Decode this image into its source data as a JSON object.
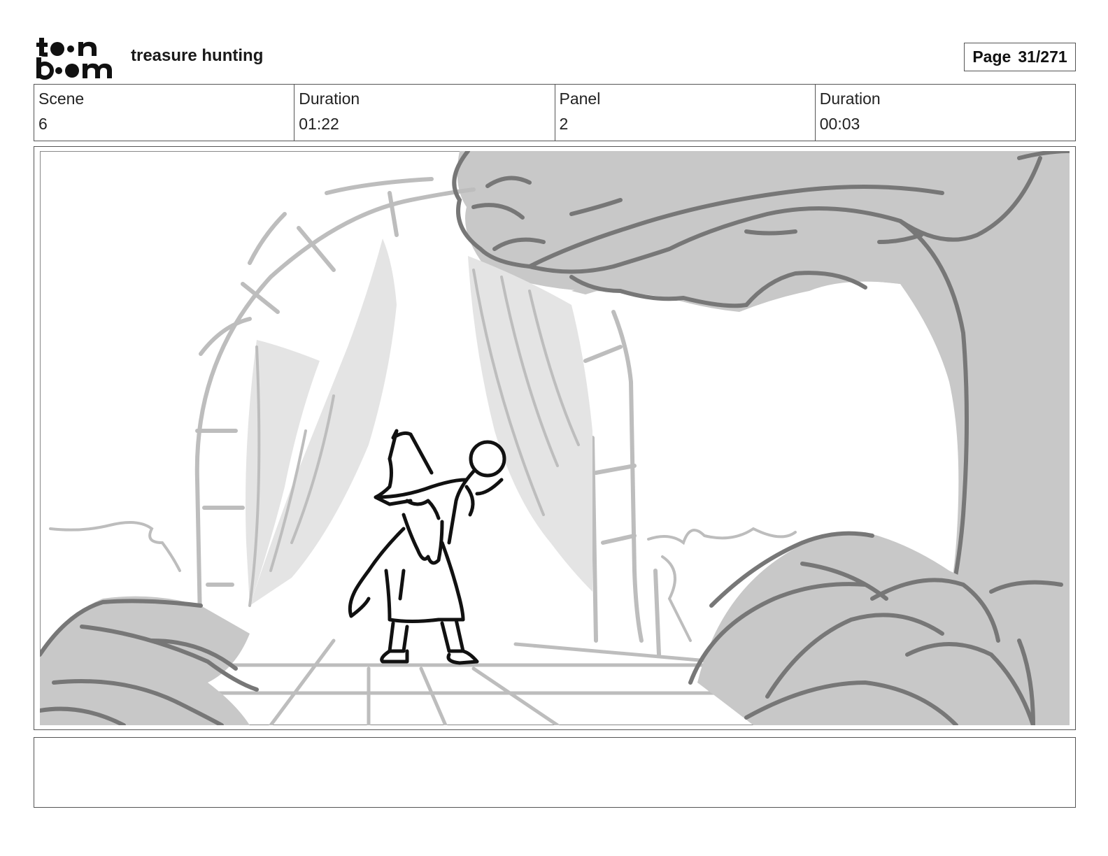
{
  "header": {
    "logo_name": "toonboom-logo",
    "title": "treasure hunting",
    "page_label": "Page",
    "page_value": "31/271"
  },
  "info": {
    "scene_label": "Scene",
    "scene_value": "6",
    "scene_duration_label": "Duration",
    "scene_duration_value": "01:22",
    "panel_label": "Panel",
    "panel_value": "2",
    "panel_duration_label": "Duration",
    "panel_duration_value": "00:03"
  },
  "panel": {
    "image_name": "storyboard-sketch-wizard-cave"
  },
  "notes": {
    "text": ""
  },
  "colors": {
    "border": "#555555",
    "shadow_fill": "#c8c8c8",
    "light_fill": "#e4e4e4",
    "line_dark": "#111111",
    "line_mid": "#777777",
    "line_light": "#bdbdbd"
  }
}
